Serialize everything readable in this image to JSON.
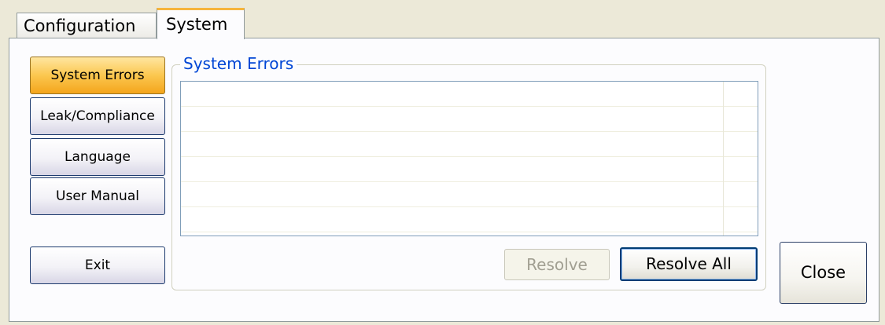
{
  "tabs": [
    {
      "label": "Configuration",
      "active": false
    },
    {
      "label": "System",
      "active": true
    }
  ],
  "sidebar": {
    "items": [
      {
        "label": "System Errors",
        "active": true
      },
      {
        "label": "Leak/Compliance",
        "active": false
      },
      {
        "label": "Language",
        "active": false
      },
      {
        "label": "User Manual",
        "active": false
      }
    ],
    "exit_label": "Exit"
  },
  "errors_group": {
    "title": "System Errors",
    "rows": [
      "",
      "",
      "",
      "",
      "",
      ""
    ],
    "resolve_label": "Resolve",
    "resolve_enabled": false,
    "resolve_all_label": "Resolve All"
  },
  "close_label": "Close",
  "colors": {
    "active_tab_accent": "#f6b53c",
    "active_button": "#fbc74f",
    "group_title": "#0046d5",
    "disabled_text": "#a19f92"
  }
}
